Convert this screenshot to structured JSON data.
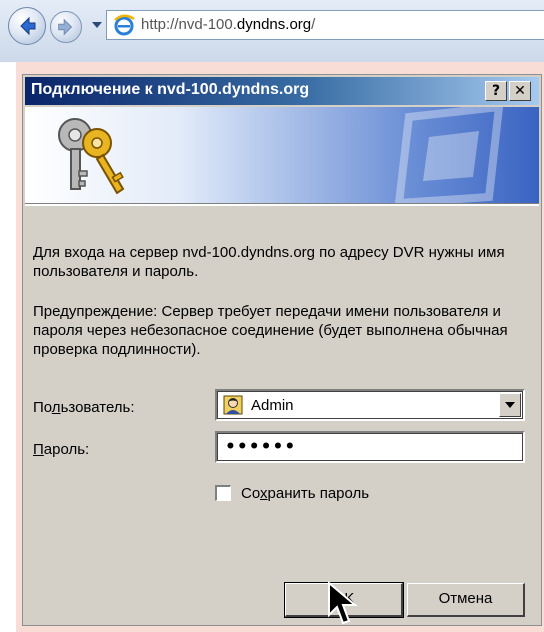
{
  "browser": {
    "address_prefix": "http://nvd-100.",
    "address_host": "dyndns.org",
    "address_suffix": "/"
  },
  "dialog": {
    "title": "Подключение к nvd-100.dyndns.org",
    "help_button": "?",
    "close_button": "✕",
    "message": "Для входа на сервер nvd-100.dyndns.org по адресу DVR нужны имя пользователя и пароль.",
    "warning": "Предупреждение: Сервер требует передачи имени пользователя и пароля через небезопасное соединение (будет выполнена обычная проверка подлинности).",
    "user_label_pre": "По",
    "user_label_acc": "л",
    "user_label_post": "ьзователь:",
    "password_label_acc": "П",
    "password_label_post": "ароль:",
    "user_value": "Admin",
    "password_value": "••••••",
    "remember_pre": "Со",
    "remember_acc": "х",
    "remember_post": "ранить пароль",
    "remember_checked": false,
    "ok_label": "OK",
    "cancel_label": "Отмена"
  }
}
